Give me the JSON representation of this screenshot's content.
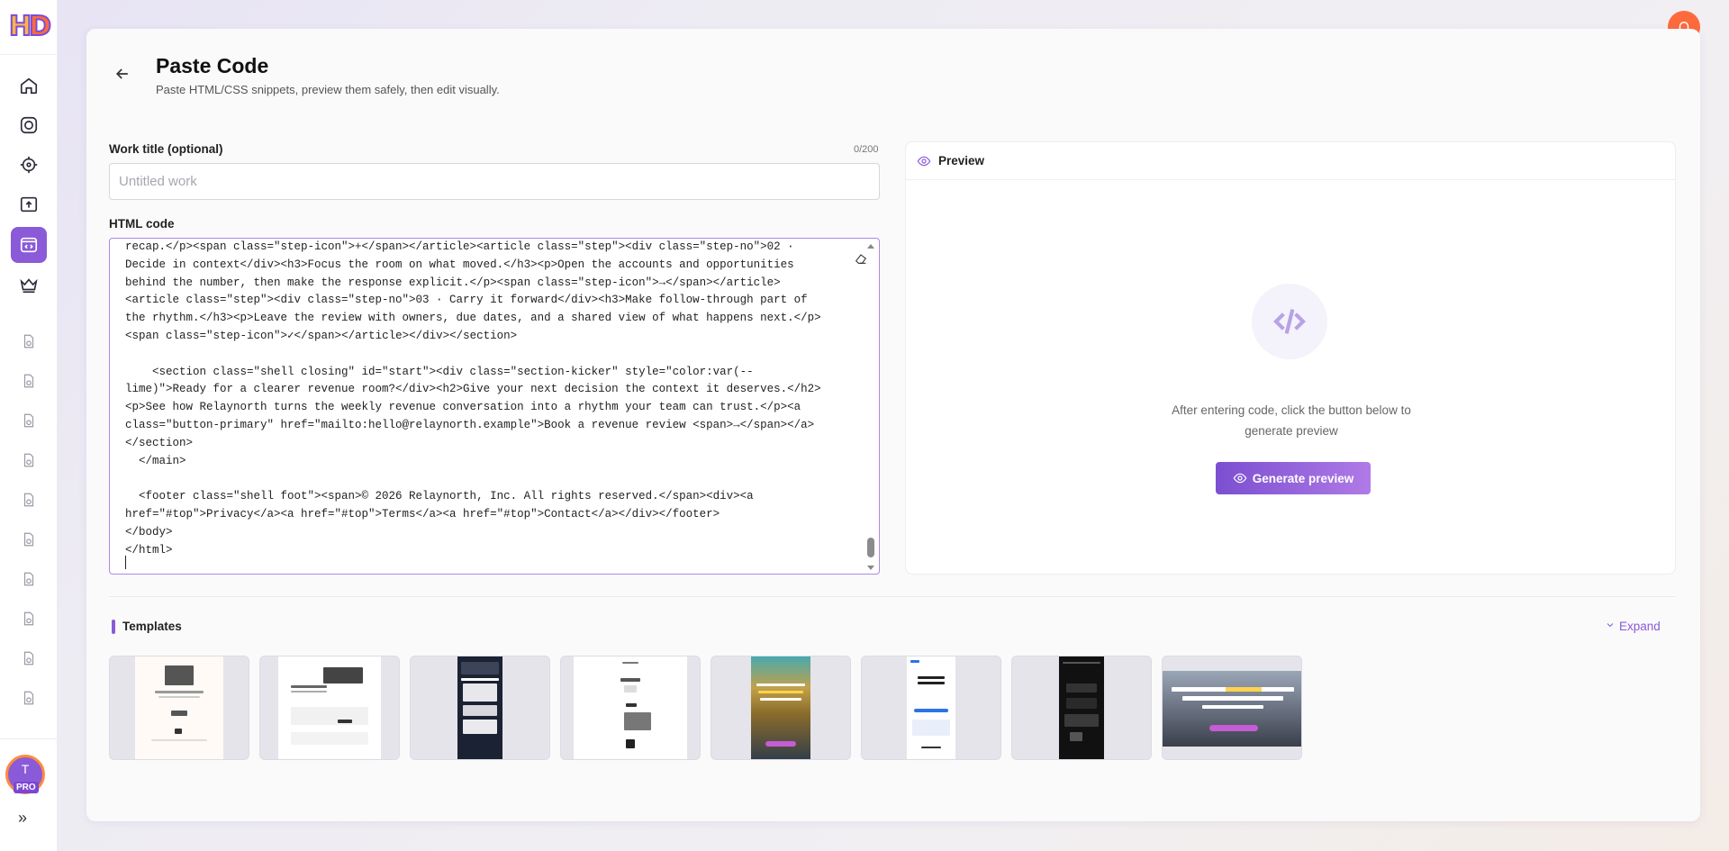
{
  "sidebar": {
    "logo_text": "HD",
    "nav": [
      {
        "name": "home",
        "icon": "home-icon"
      },
      {
        "name": "camera",
        "icon": "camera-icon"
      },
      {
        "name": "target",
        "icon": "crosshair-icon"
      },
      {
        "name": "upload",
        "icon": "upload-icon"
      },
      {
        "name": "paste-code",
        "icon": "code-window-icon",
        "active": true
      },
      {
        "name": "premium",
        "icon": "crown-icon"
      }
    ],
    "history_count": 10,
    "avatar": {
      "initial": "T",
      "badge": "PRO"
    },
    "expand_glyph": "»"
  },
  "header": {
    "title": "Paste Code",
    "subtitle": "Paste HTML/CSS snippets, preview them safely, then edit visually."
  },
  "form": {
    "work_title_label": "Work title (optional)",
    "work_title_counter": "0/200",
    "work_title_placeholder": "Untitled work",
    "work_title_value": "",
    "html_label": "HTML code",
    "code_lines": [
      "recap.</p><span class=\"step-icon\">+</span></article><article class=\"step\"><div class=\"step-no\">02 ·",
      "Decide in context</div><h3>Focus the room on what moved.</h3><p>Open the accounts and opportunities",
      "behind the number, then make the response explicit.</p><span class=\"step-icon\">→</span></article>",
      "<article class=\"step\"><div class=\"step-no\">03 · Carry it forward</div><h3>Make follow-through part of",
      "the rhythm.</h3><p>Leave the review with owners, due dates, and a shared view of what happens next.</p>",
      "<span class=\"step-icon\">✓</span></article></div></section>",
      "",
      "    <section class=\"shell closing\" id=\"start\"><div class=\"section-kicker\" style=\"color:var(--",
      "lime)\">Ready for a clearer revenue room?</div><h2>Give your next decision the context it deserves.</h2>",
      "<p>See how Relaynorth turns the weekly revenue conversation into a rhythm your team can trust.</p><a",
      "class=\"button-primary\" href=\"mailto:hello@relaynorth.example\">Book a revenue review <span>→</span></a>",
      "</section>",
      "  </main>",
      "",
      "  <footer class=\"shell foot\"><span>© 2026 Relaynorth, Inc. All rights reserved.</span><div><a",
      "href=\"#top\">Privacy</a><a href=\"#top\">Terms</a><a href=\"#top\">Contact</a></div></footer>",
      "</body>",
      "</html>"
    ]
  },
  "preview": {
    "title": "Preview",
    "message": "After entering code, click the button below to generate preview",
    "button_label": "Generate preview"
  },
  "templates": {
    "title": "Templates",
    "expand_label": "Expand",
    "items": [
      {
        "style": "light-portrait"
      },
      {
        "style": "light-portrait"
      },
      {
        "style": "dark-portrait"
      },
      {
        "style": "light-portrait"
      },
      {
        "style": "colorful-portrait"
      },
      {
        "style": "light-mobile"
      },
      {
        "style": "dark-mobile"
      },
      {
        "style": "landscape-banner"
      }
    ]
  },
  "colors": {
    "accent": "#8a5ad8",
    "alert": "#ff6a3d"
  }
}
